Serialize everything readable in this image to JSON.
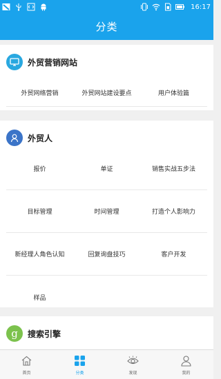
{
  "status_bar": {
    "time": "16:17",
    "left_icons": [
      "app-icon",
      "usb-icon",
      "code-icon",
      "android-icon"
    ],
    "right_icons": [
      "vibrate-icon",
      "wifi-icon",
      "sim-icon",
      "battery-icon"
    ]
  },
  "header": {
    "title": "分类"
  },
  "sections": [
    {
      "title": "外贸营销网站",
      "icon": "monitor-icon",
      "icon_color": "#29a8e0",
      "rows": [
        [
          "外贸网络营销",
          "外贸网站建设要点",
          "用户体验篇"
        ]
      ]
    },
    {
      "title": "外贸人",
      "icon": "person-icon",
      "icon_color": "#3b74c8",
      "rows": [
        [
          "报价",
          "单证",
          "销售实战五步法"
        ],
        [
          "目标管理",
          "时间管理",
          "打造个人影响力"
        ],
        [
          "新经理人角色认知",
          "回复询盘技巧",
          "客户开发"
        ],
        [
          "样品"
        ]
      ]
    },
    {
      "title": "搜索引擎",
      "icon": "g-icon",
      "icon_color": "#7cc24d",
      "rows": []
    }
  ],
  "tabbar": {
    "items": [
      {
        "label": "首页",
        "icon": "home-icon"
      },
      {
        "label": "分类",
        "icon": "grid-icon"
      },
      {
        "label": "发现",
        "icon": "eye-icon"
      },
      {
        "label": "我的",
        "icon": "user-icon"
      }
    ],
    "active_index": 1,
    "active_color": "#1aa3ec"
  }
}
